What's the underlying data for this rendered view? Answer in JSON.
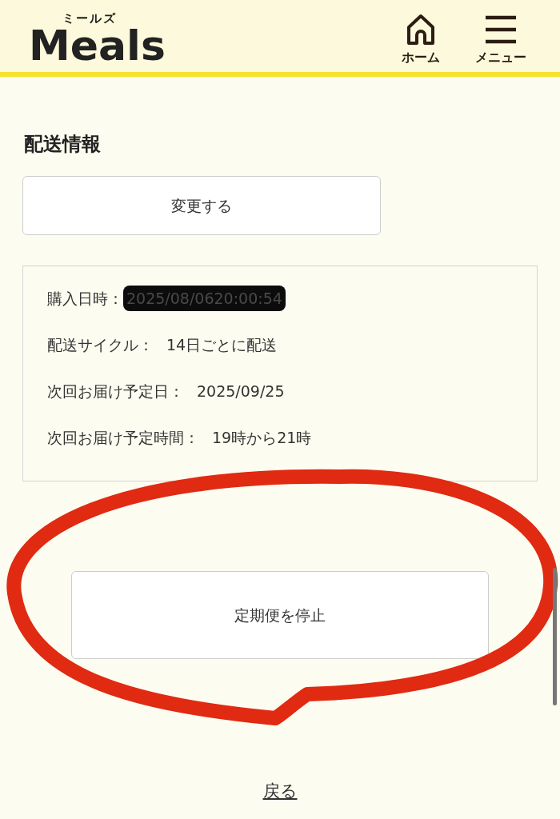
{
  "header": {
    "logo_ruby": "ミールズ",
    "logo": "Meals",
    "nav": [
      {
        "label": "ホーム",
        "kind": "home"
      },
      {
        "label": "メニュー",
        "kind": "menu"
      }
    ]
  },
  "section": {
    "title": "配送情報",
    "change_button": "変更する",
    "info": [
      {
        "label": "購入日時：",
        "value": "2025/08/0620:00:54",
        "redacted": true
      },
      {
        "label": "配送サイクル：",
        "value": "14日ごとに配送",
        "redacted": false
      },
      {
        "label": "次回お届け予定日：",
        "value": "2025/09/25",
        "redacted": false
      },
      {
        "label": "次回お届け予定時間：",
        "value": "19時から21時",
        "redacted": false
      }
    ],
    "stop_button": "定期便を停止"
  },
  "back_link": "戻る"
}
